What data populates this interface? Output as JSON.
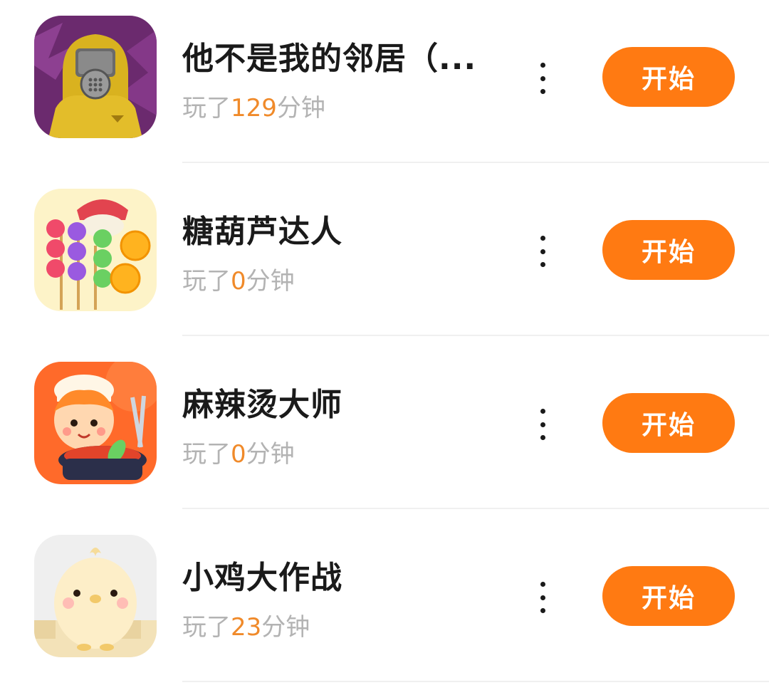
{
  "games": [
    {
      "title": "他不是我的邻居（...",
      "played_prefix": "玩了",
      "played_minutes": "129",
      "played_suffix": "分钟",
      "start_label": "开始",
      "icon": "hazmat-suit-figure-icon"
    },
    {
      "title": "糖葫芦达人",
      "played_prefix": "玩了",
      "played_minutes": "0",
      "played_suffix": "分钟",
      "start_label": "开始",
      "icon": "candied-fruit-skewers-icon"
    },
    {
      "title": "麻辣烫大师",
      "played_prefix": "玩了",
      "played_minutes": "0",
      "played_suffix": "分钟",
      "start_label": "开始",
      "icon": "chef-with-hotpot-icon"
    },
    {
      "title": "小鸡大作战",
      "played_prefix": "玩了",
      "played_minutes": "23",
      "played_suffix": "分钟",
      "start_label": "开始",
      "icon": "chick-character-icon"
    }
  ],
  "colors": {
    "accent": "#ff7a12",
    "minutes_highlight": "#f08a2a",
    "subtext": "#b3b3b3",
    "title": "#1a1a1a"
  }
}
